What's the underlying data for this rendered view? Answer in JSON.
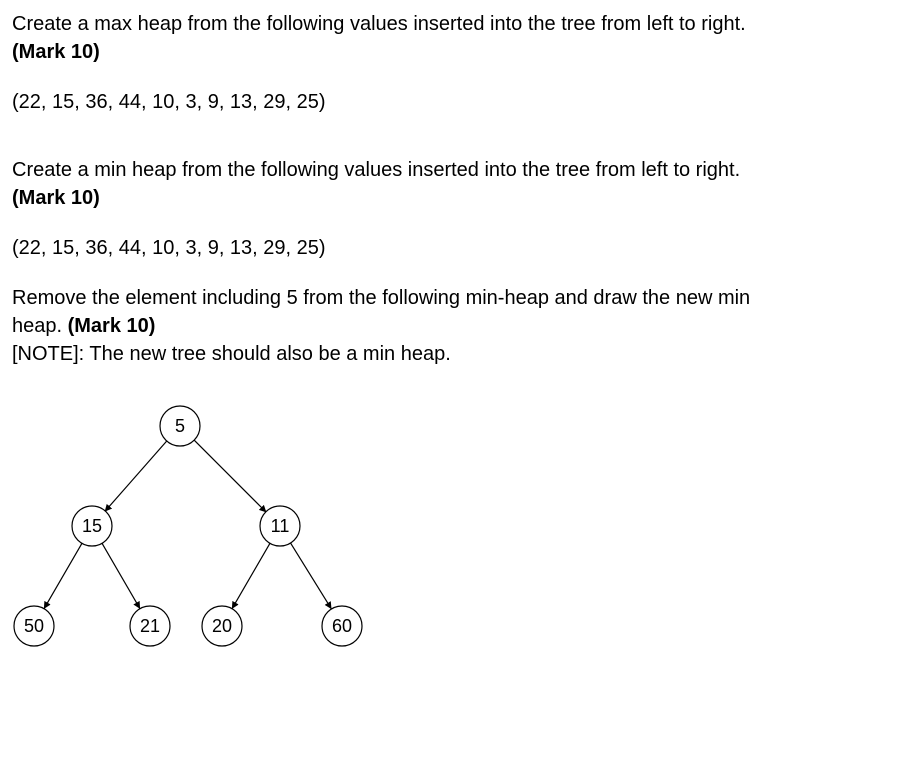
{
  "q1": {
    "prompt": "Create a max heap from the following values inserted into the tree from left to right.",
    "mark_label": "(Mark 10)",
    "values": "(22, 15, 36, 44, 10, 3, 9, 13, 29, 25)"
  },
  "q2": {
    "prompt": "Create a min heap from the following values inserted into the tree from left to right.",
    "mark_label": "(Mark 10)",
    "values": "(22, 15, 36, 44, 10, 3, 9, 13, 29, 25)"
  },
  "q3": {
    "line1": "Remove the element including 5 from the following min-heap and draw the new min",
    "line2_prefix": "heap.  ",
    "mark_label": "(Mark 10)",
    "note": "[NOTE]: The new tree should also be a min heap."
  },
  "tree": {
    "nodes": {
      "root": "5",
      "l": "15",
      "r": "11",
      "ll": "50",
      "lr": "21",
      "rl": "20",
      "rr": "60"
    }
  }
}
